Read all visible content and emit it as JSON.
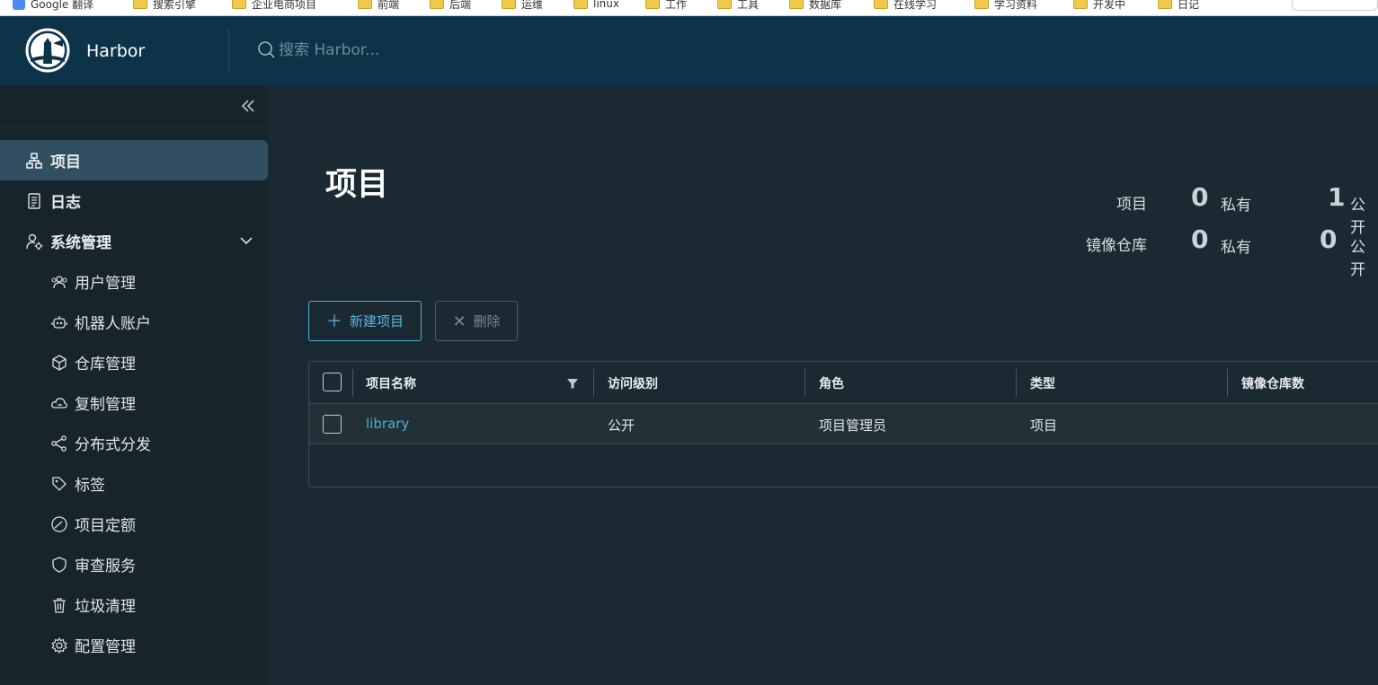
{
  "bookmarks": [
    {
      "label": "Google 翻译",
      "icon": "google-icon"
    },
    {
      "label": "搜索引擎",
      "icon": "folder-icon"
    },
    {
      "label": "企业电商项目",
      "icon": "folder-icon"
    },
    {
      "label": "前端",
      "icon": "folder-icon"
    },
    {
      "label": "后端",
      "icon": "folder-icon"
    },
    {
      "label": "运维",
      "icon": "folder-icon"
    },
    {
      "label": "linux",
      "icon": "folder-icon"
    },
    {
      "label": "工作",
      "icon": "folder-icon"
    },
    {
      "label": "工具",
      "icon": "folder-icon"
    },
    {
      "label": "数据库",
      "icon": "folder-icon"
    },
    {
      "label": "在线学习",
      "icon": "folder-icon"
    },
    {
      "label": "学习资料",
      "icon": "folder-icon"
    },
    {
      "label": "开发中",
      "icon": "folder-icon"
    },
    {
      "label": "日记",
      "icon": "folder-icon"
    }
  ],
  "header": {
    "brand": "Harbor",
    "search_placeholder": "搜索 Harbor..."
  },
  "sidebar": {
    "items": [
      {
        "label": "项目",
        "icon": "project-icon",
        "active": true
      },
      {
        "label": "日志",
        "icon": "log-icon"
      },
      {
        "label": "系统管理",
        "icon": "admin-icon",
        "expanded": true
      }
    ],
    "sub_items": [
      {
        "label": "用户管理",
        "icon": "users-icon"
      },
      {
        "label": "机器人账户",
        "icon": "robot-icon"
      },
      {
        "label": "仓库管理",
        "icon": "box-icon"
      },
      {
        "label": "复制管理",
        "icon": "cloud-sync-icon"
      },
      {
        "label": "分布式分发",
        "icon": "share-icon"
      },
      {
        "label": "标签",
        "icon": "tag-icon"
      },
      {
        "label": "项目定额",
        "icon": "gauge-icon"
      },
      {
        "label": "审查服务",
        "icon": "shield-icon"
      },
      {
        "label": "垃圾清理",
        "icon": "trash-icon"
      },
      {
        "label": "配置管理",
        "icon": "gear-icon"
      }
    ]
  },
  "main": {
    "title": "项目",
    "stats": [
      {
        "label": "项目",
        "private_count": "0",
        "private_label": "私有",
        "public_count": "1",
        "public_label": "公开"
      },
      {
        "label": "镜像仓库",
        "private_count": "0",
        "private_label": "私有",
        "public_count": "0",
        "public_label": "公开"
      }
    ],
    "buttons": {
      "new_project": "新建项目",
      "delete": "删除"
    },
    "table": {
      "columns": [
        "项目名称",
        "访问级别",
        "角色",
        "类型",
        "镜像仓库数"
      ],
      "rows": [
        {
          "name": "library",
          "access": "公开",
          "role": "项目管理员",
          "type": "项目",
          "repo_count": ""
        }
      ]
    }
  },
  "colors": {
    "header_bg": "#0d3349",
    "sidebar_bg": "#17242b",
    "main_bg": "#1b2a32",
    "active_item": "#324f62",
    "accent": "#49afd9"
  }
}
